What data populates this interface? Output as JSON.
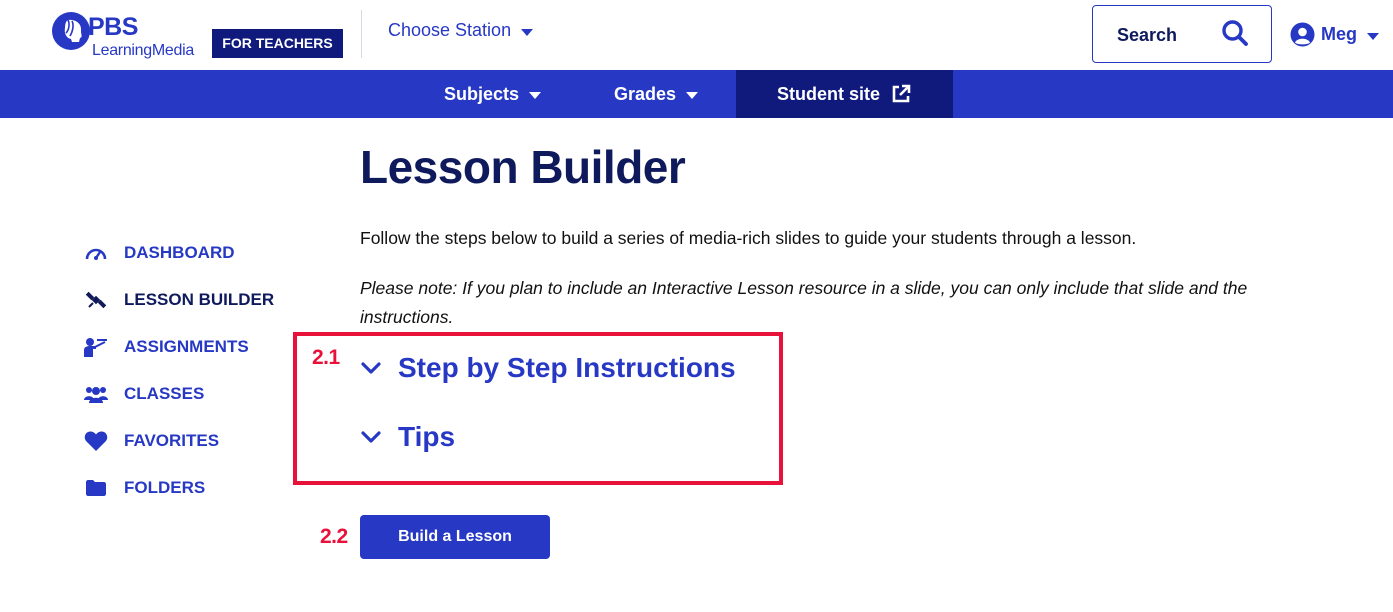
{
  "header": {
    "logo_pbs": "PBS",
    "logo_subtitle": "LearningMedia",
    "badge": "FOR TEACHERS",
    "station_label": "Choose Station",
    "search_label": "Search",
    "user_name": "Meg"
  },
  "navbar": {
    "items": [
      {
        "label": "Subjects",
        "icon": "chevron-down-icon"
      },
      {
        "label": "Grades",
        "icon": "chevron-down-icon"
      },
      {
        "label": "Student site",
        "icon": "external-link-icon"
      }
    ]
  },
  "sidebar": {
    "items": [
      {
        "label": "DASHBOARD",
        "icon": "gauge-icon"
      },
      {
        "label": "LESSON BUILDER",
        "icon": "satellite-icon",
        "active": true
      },
      {
        "label": "ASSIGNMENTS",
        "icon": "teacher-board-icon"
      },
      {
        "label": "CLASSES",
        "icon": "users-icon"
      },
      {
        "label": "FAVORITES",
        "icon": "heart-icon"
      },
      {
        "label": "FOLDERS",
        "icon": "folder-icon"
      }
    ]
  },
  "main": {
    "title": "Lesson Builder",
    "intro": "Follow the steps below to build a series of media-rich slides to guide your students through a lesson.",
    "note": "Please note: If you plan to include an Interactive Lesson resource in a slide, you can only include that slide and the instructions.",
    "accordions": [
      {
        "label": "Step by Step Instructions"
      },
      {
        "label": "Tips"
      }
    ],
    "build_button": "Build a Lesson"
  },
  "annotations": {
    "step_1": "2.1",
    "step_2": "2.2",
    "highlight_color": "#e8113a"
  },
  "colors": {
    "brand_blue": "#2638c4",
    "navy": "#0f1a7c",
    "text_dark": "#0f1a5c"
  }
}
